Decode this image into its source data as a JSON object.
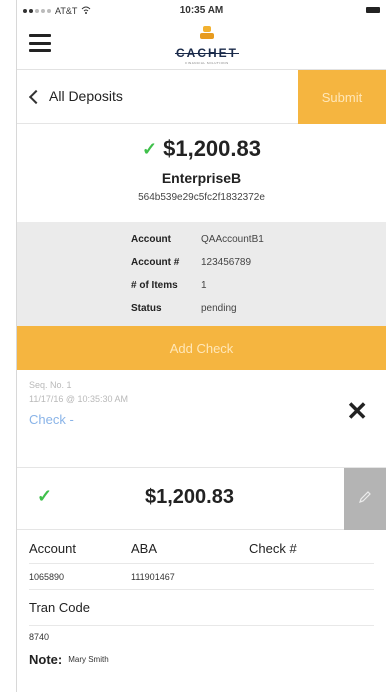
{
  "status_bar": {
    "carrier": "AT&T",
    "time": "10:35 AM"
  },
  "header": {
    "menu_icon": "hamburger-menu-icon",
    "logo_text": "CACHET",
    "logo_tagline": "FINANCIAL SOLUTIONS",
    "brand_color": "#f5b540"
  },
  "nav": {
    "back_label": "All Deposits",
    "submit_label": "Submit"
  },
  "deposit": {
    "amount": "$1,200.83",
    "name": "EnterpriseB",
    "id": "564b539e29c5fc2f1832372e",
    "details": [
      {
        "label": "Account",
        "value": "QAAccountB1"
      },
      {
        "label": "Account #",
        "value": "123456789"
      },
      {
        "label": "# of Items",
        "value": "1"
      },
      {
        "label": "Status",
        "value": "pending"
      }
    ]
  },
  "add_check_label": "Add Check",
  "check_item": {
    "seq": "Seq. No. 1",
    "timestamp": "11/17/16 @ 10:35:30 AM",
    "link_label": "Check -",
    "close_icon": "close-icon"
  },
  "check_detail": {
    "amount": "$1,200.83",
    "headers": {
      "account": "Account",
      "aba": "ABA",
      "check_no": "Check #"
    },
    "values": {
      "account": "1065890",
      "aba": "111901467",
      "check_no": ""
    },
    "tran_code_label": "Tran Code",
    "tran_code_value": "8740",
    "note_label": "Note:",
    "note_value": "Mary Smith"
  }
}
